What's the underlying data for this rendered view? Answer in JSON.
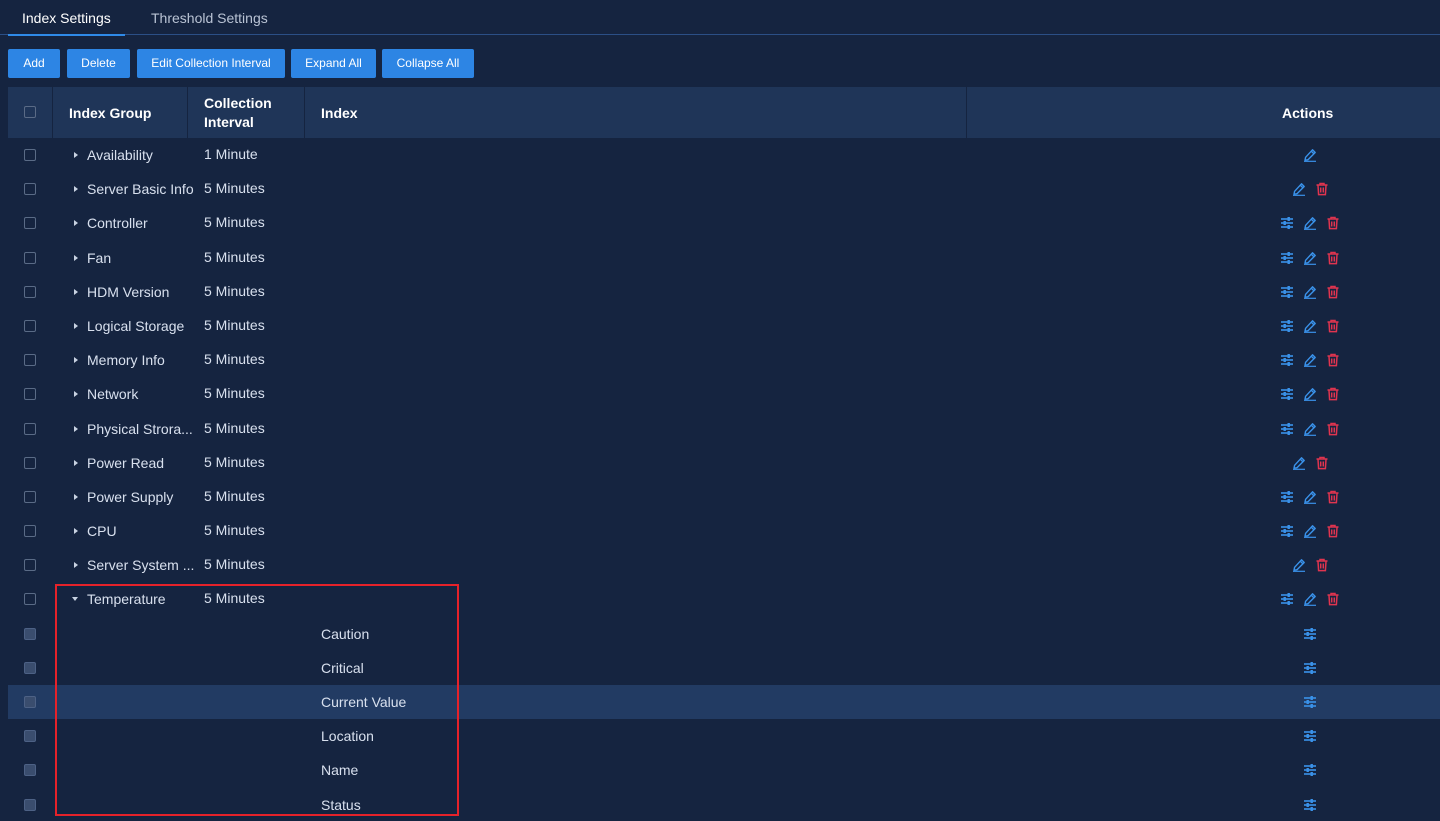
{
  "tabs": [
    {
      "label": "Index Settings",
      "active": true
    },
    {
      "label": "Threshold Settings",
      "active": false
    }
  ],
  "toolbar": {
    "add": "Add",
    "delete": "Delete",
    "edit_interval": "Edit Collection Interval",
    "expand_all": "Expand All",
    "collapse_all": "Collapse All"
  },
  "table": {
    "headers": {
      "index_group": "Index Group",
      "collection_interval_line1": "Collection",
      "collection_interval_line2": "Interval",
      "index": "Index",
      "actions": "Actions"
    },
    "groups": [
      {
        "name": "Availability",
        "interval": "1 Minute",
        "actions": [
          "edit"
        ]
      },
      {
        "name": "Server Basic Info",
        "interval": "5 Minutes",
        "actions": [
          "edit",
          "delete"
        ]
      },
      {
        "name": "Controller",
        "interval": "5 Minutes",
        "actions": [
          "settings",
          "edit",
          "delete"
        ]
      },
      {
        "name": "Fan",
        "interval": "5 Minutes",
        "actions": [
          "settings",
          "edit",
          "delete"
        ]
      },
      {
        "name": "HDM Version",
        "interval": "5 Minutes",
        "actions": [
          "settings",
          "edit",
          "delete"
        ]
      },
      {
        "name": "Logical Storage",
        "interval": "5 Minutes",
        "actions": [
          "settings",
          "edit",
          "delete"
        ]
      },
      {
        "name": "Memory Info",
        "interval": "5 Minutes",
        "actions": [
          "settings",
          "edit",
          "delete"
        ]
      },
      {
        "name": "Network",
        "interval": "5 Minutes",
        "actions": [
          "settings",
          "edit",
          "delete"
        ]
      },
      {
        "name": "Physical Strora...",
        "interval": "5 Minutes",
        "actions": [
          "settings",
          "edit",
          "delete"
        ]
      },
      {
        "name": "Power Read",
        "interval": "5 Minutes",
        "actions": [
          "edit",
          "delete"
        ]
      },
      {
        "name": "Power Supply",
        "interval": "5 Minutes",
        "actions": [
          "settings",
          "edit",
          "delete"
        ]
      },
      {
        "name": "CPU",
        "interval": "5 Minutes",
        "actions": [
          "settings",
          "edit",
          "delete"
        ]
      },
      {
        "name": "Server System ...",
        "interval": "5 Minutes",
        "actions": [
          "edit",
          "delete"
        ]
      },
      {
        "name": "Temperature",
        "interval": "5 Minutes",
        "actions": [
          "settings",
          "edit",
          "delete"
        ],
        "expanded": true,
        "children": [
          {
            "index": "Caution",
            "actions": [
              "settings"
            ]
          },
          {
            "index": "Critical",
            "actions": [
              "settings"
            ]
          },
          {
            "index": "Current Value",
            "actions": [
              "settings"
            ],
            "hovered": true
          },
          {
            "index": "Location",
            "actions": [
              "settings"
            ]
          },
          {
            "index": "Name",
            "actions": [
              "settings"
            ]
          },
          {
            "index": "Status",
            "actions": [
              "settings"
            ]
          }
        ]
      }
    ]
  },
  "icons": {
    "settings": "sliders-icon",
    "edit": "pencil-icon",
    "delete": "trash-icon"
  },
  "colors": {
    "background": "#152440",
    "header": "#1f3558",
    "button": "#2d85e4",
    "icon_blue": "#3a92ea",
    "icon_red": "#e0344f",
    "highlight_border": "#e5222a"
  }
}
